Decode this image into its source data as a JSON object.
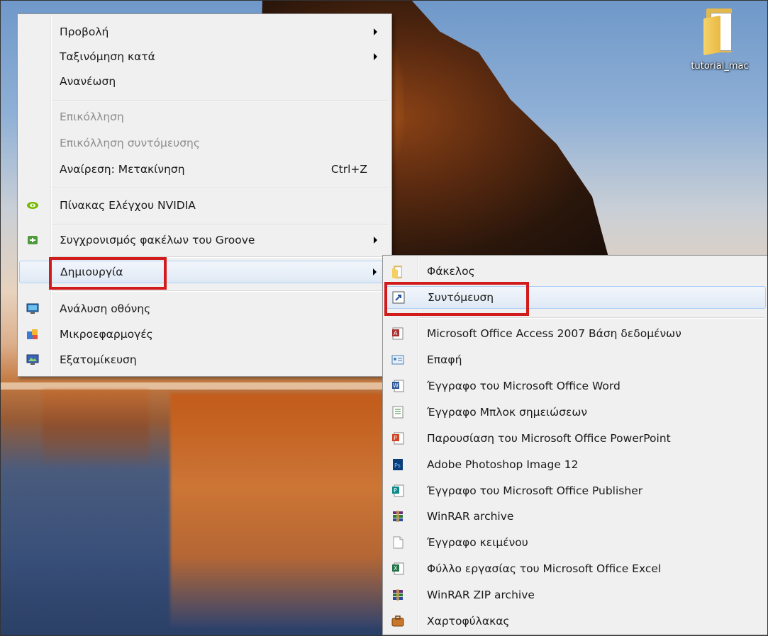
{
  "desktop": {
    "icon_label": "tutorial_mac",
    "icon_name": "folder-icon"
  },
  "context_menu": {
    "items": [
      {
        "label": "Προβολή",
        "has_submenu": true
      },
      {
        "label": "Ταξινόμηση κατά",
        "has_submenu": true
      },
      {
        "label": "Ανανέωση"
      },
      {
        "label": "Επικόλληση",
        "disabled": true
      },
      {
        "label": "Επικόλληση συντόμευσης",
        "disabled": true
      },
      {
        "label": "Αναίρεση: Μετακίνηση",
        "shortcut": "Ctrl+Z"
      },
      {
        "label": "Πίνακας Ελέγχου NVIDIA",
        "icon": "nvidia-icon"
      },
      {
        "label": "Συγχρονισμός φακέλων του Groove",
        "icon": "groove-icon",
        "has_submenu": true
      },
      {
        "label": "Δημιουργία",
        "has_submenu": true,
        "highlighted": true
      },
      {
        "label": "Ανάλυση οθόνης",
        "icon": "display-icon"
      },
      {
        "label": "Μικροεφαρμογές",
        "icon": "gadgets-icon"
      },
      {
        "label": "Εξατομίκευση",
        "icon": "personalize-icon"
      }
    ]
  },
  "new_submenu": {
    "items": [
      {
        "label": "Φάκελος",
        "icon": "folder-icon"
      },
      {
        "label": "Συντόμευση",
        "icon": "shortcut-icon",
        "highlighted": true
      },
      {
        "label": "Microsoft Office Access 2007 Βάση δεδομένων",
        "icon": "access-icon"
      },
      {
        "label": "Επαφή",
        "icon": "contact-icon"
      },
      {
        "label": "Έγγραφο του Microsoft Office Word",
        "icon": "word-icon"
      },
      {
        "label": "Έγγραφο Μπλοκ σημειώσεων",
        "icon": "journal-icon"
      },
      {
        "label": "Παρουσίαση του Microsoft Office PowerPoint",
        "icon": "powerpoint-icon"
      },
      {
        "label": "Adobe Photoshop Image 12",
        "icon": "photoshop-icon"
      },
      {
        "label": "Έγγραφο του Microsoft Office Publisher",
        "icon": "publisher-icon"
      },
      {
        "label": "WinRAR archive",
        "icon": "winrar-icon"
      },
      {
        "label": "Έγγραφο κειμένου",
        "icon": "text-document-icon"
      },
      {
        "label": "Φύλλο εργασίας του Microsoft Office Excel",
        "icon": "excel-icon"
      },
      {
        "label": "WinRAR ZIP archive",
        "icon": "winrar-zip-icon"
      },
      {
        "label": "Χαρτοφύλακας",
        "icon": "briefcase-icon"
      }
    ]
  },
  "colors": {
    "menu_bg": "#f0f0f0",
    "highlight_border": "#aecff7",
    "annotation_red": "#d11c1c",
    "disabled_text": "#8d8d8d"
  }
}
